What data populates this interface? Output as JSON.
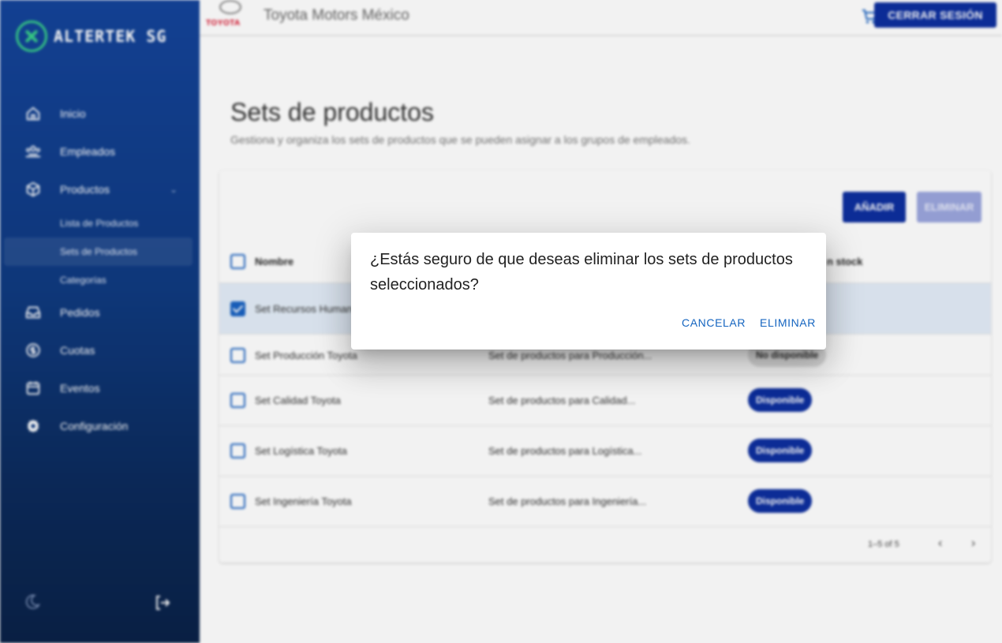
{
  "brand": {
    "name": "ALTERTEK SG"
  },
  "sidebar": {
    "items": [
      {
        "label": "Inicio",
        "icon": "home-icon"
      },
      {
        "label": "Empleados",
        "icon": "people-icon"
      },
      {
        "label": "Productos",
        "icon": "cube-icon"
      },
      {
        "label": "Pedidos",
        "icon": "inbox-icon"
      },
      {
        "label": "Cuotas",
        "icon": "currency-icon"
      },
      {
        "label": "Eventos",
        "icon": "calendar-icon"
      },
      {
        "label": "Configuración",
        "icon": "gear-icon"
      }
    ],
    "subitems": [
      {
        "label": "Lista de Productos"
      },
      {
        "label": "Sets de Productos"
      },
      {
        "label": "Categorías"
      }
    ]
  },
  "topbar": {
    "logo_text": "TOYOTA",
    "company": "Toyota Motors México",
    "logout_label": "CERRAR SESIÓN"
  },
  "page": {
    "title": "Sets de productos",
    "subtitle": "Gestiona y organiza los sets de productos que se pueden asignar a los grupos de empleados."
  },
  "toolbar": {
    "add_label": "AÑADIR",
    "delete_label": "ELIMINAR"
  },
  "table": {
    "header_name": "Nombre",
    "header_stock": "n stock",
    "rows": [
      {
        "name": "Set Recursos Humanos",
        "desc": "",
        "status": "",
        "checked": true
      },
      {
        "name": "Set Producción Toyota",
        "desc": "Set de productos para Producción...",
        "status": "No disponible",
        "checked": false
      },
      {
        "name": "Set Calidad Toyota",
        "desc": "Set de productos para Calidad...",
        "status": "Disponible",
        "checked": false
      },
      {
        "name": "Set Logística Toyota",
        "desc": "Set de productos para Logística...",
        "status": "Disponible",
        "checked": false
      },
      {
        "name": "Set Ingeniería Toyota",
        "desc": "Set de productos para Ingeniería...",
        "status": "Disponible",
        "checked": false
      }
    ],
    "pagination": "1–5 of 5"
  },
  "dialog": {
    "message": "¿Estás seguro de que deseas eliminar los sets de productos seleccionados?",
    "cancel_label": "CANCELAR",
    "confirm_label": "ELIMINAR"
  },
  "colors": {
    "primary": "#0d2f9f",
    "sidebar_top": "#14449a",
    "sidebar_bottom": "#0a2147",
    "link": "#1565c0",
    "selected_row": "#e3edf8"
  }
}
